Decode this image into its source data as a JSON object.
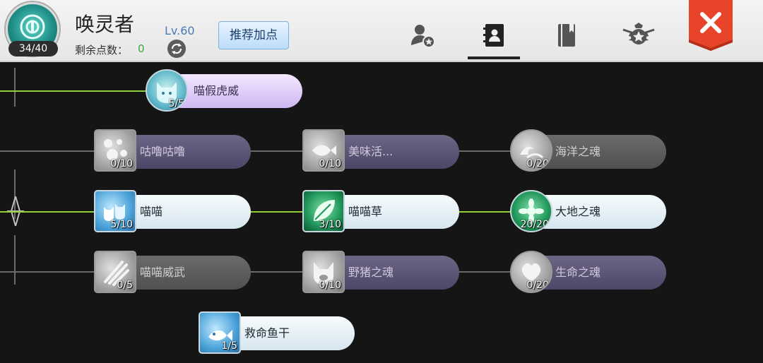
{
  "header": {
    "avatar_count": "34/40",
    "name": "唤灵者",
    "points_label": "剩余点数：",
    "points_value": "0",
    "level": "Lv.60",
    "recommend_label": "推荐加点",
    "tabs": [
      {
        "icon": "character-star-icon",
        "active": false
      },
      {
        "icon": "contacts-book-icon",
        "active": true
      },
      {
        "icon": "book-icon",
        "active": false
      },
      {
        "icon": "winged-star-badge-icon",
        "active": false
      }
    ],
    "close_icon": "close-x-icon"
  },
  "tree": {
    "nodes": [
      {
        "id": "n1",
        "name": "喵假虎威",
        "count": "5/5",
        "style": "lavender",
        "shape": "circle",
        "art": "teal",
        "icon": "cat-face-icon"
      },
      {
        "id": "n2",
        "name": "咕噜咕噜",
        "count": "0/10",
        "style": "purple",
        "shape": "square",
        "art": "grey",
        "icon": "bubbles-cat-icon"
      },
      {
        "id": "n3",
        "name": "美味活...",
        "count": "0/10",
        "style": "purple",
        "shape": "square",
        "art": "grey",
        "icon": "fish-food-icon"
      },
      {
        "id": "n4",
        "name": "海洋之魂",
        "count": "0/20",
        "style": "grey",
        "shape": "circle",
        "art": "grey",
        "icon": "wave-icon"
      },
      {
        "id": "n5",
        "name": "喵喵",
        "count": "5/10",
        "style": "light",
        "shape": "square",
        "art": "blue",
        "icon": "cats-icon"
      },
      {
        "id": "n6",
        "name": "喵喵草",
        "count": "3/10",
        "style": "light",
        "shape": "square",
        "art": "green",
        "icon": "leaf-icon"
      },
      {
        "id": "n7",
        "name": "大地之魂",
        "count": "20/20",
        "style": "light",
        "shape": "circle",
        "art": "green",
        "icon": "lotus-icon"
      },
      {
        "id": "n8",
        "name": "喵喵威武",
        "count": "0/5",
        "style": "grey",
        "shape": "square",
        "art": "grey",
        "icon": "claw-icon"
      },
      {
        "id": "n9",
        "name": "野猪之魂",
        "count": "0/10",
        "style": "purple",
        "shape": "square",
        "art": "grey",
        "icon": "boar-icon"
      },
      {
        "id": "n10",
        "name": "生命之魂",
        "count": "0/20",
        "style": "purple",
        "shape": "circle",
        "art": "grey",
        "icon": "heart-icon"
      },
      {
        "id": "n11",
        "name": "救命鱼干",
        "count": "1/5",
        "style": "light",
        "shape": "square",
        "art": "blue",
        "icon": "dried-fish-icon"
      }
    ],
    "colors": {
      "active_line": "#8fd13a",
      "inactive_line": "#6a6a6a",
      "close_button": "#e8442a"
    }
  }
}
